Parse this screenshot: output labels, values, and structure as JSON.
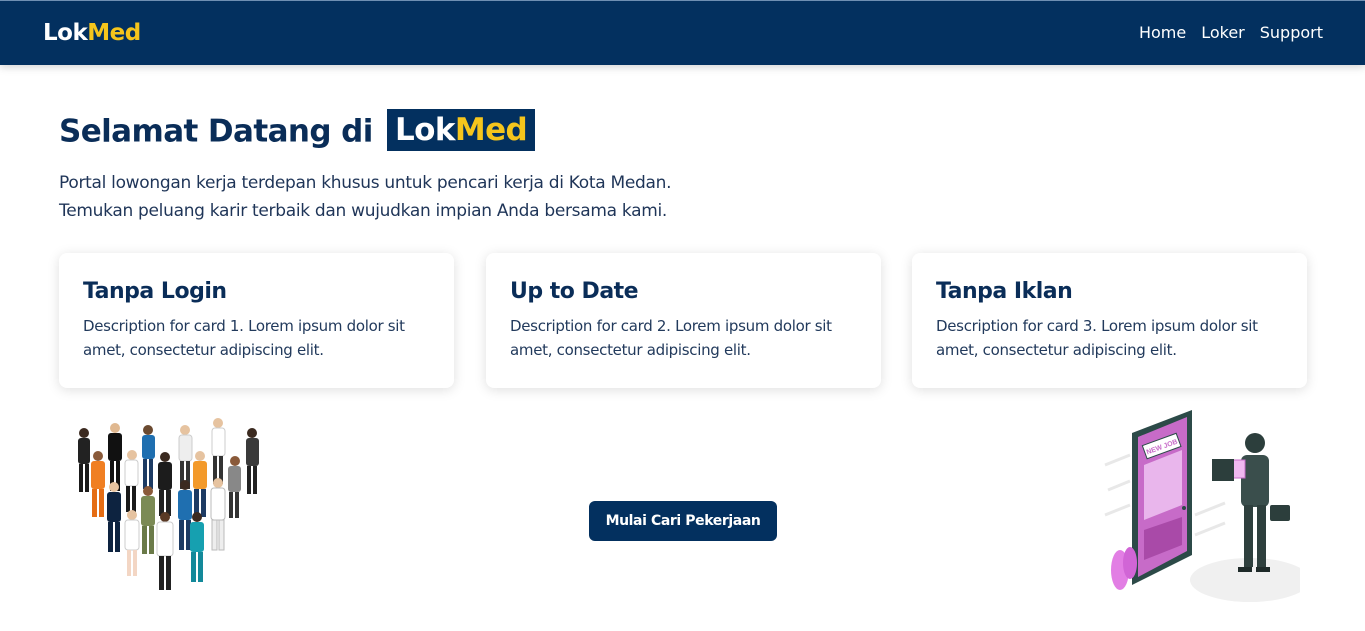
{
  "nav": {
    "brand_part1": "Lok",
    "brand_part2": "Med",
    "links": [
      "Home",
      "Loker",
      "Support"
    ]
  },
  "hero": {
    "title_prefix": "Selamat Datang di",
    "badge_part1": "Lok",
    "badge_part2": "Med",
    "subtitle_line1": "Portal lowongan kerja terdepan khusus untuk pencari kerja di Kota Medan.",
    "subtitle_line2": "Temukan peluang karir terbaik dan wujudkan impian Anda bersama kami."
  },
  "cards": [
    {
      "title": "Tanpa Login",
      "desc": "Description for card 1. Lorem ipsum dolor sit amet, consectetur adipiscing elit."
    },
    {
      "title": "Up to Date",
      "desc": "Description for card 2. Lorem ipsum dolor sit amet, consectetur adipiscing elit."
    },
    {
      "title": "Tanpa Iklan",
      "desc": "Description for card 3. Lorem ipsum dolor sit amet, consectetur adipiscing elit."
    }
  ],
  "cta": {
    "label": "Mulai Cari Pekerjaan"
  },
  "illustrations": {
    "left": "workers-crowd-illustration",
    "right": "new-job-door-illustration",
    "door_sign": "NEW JOB"
  },
  "colors": {
    "navy": "#03305f",
    "brand_yellow": "#f5c51c",
    "door_purple": "#c76bc8"
  }
}
